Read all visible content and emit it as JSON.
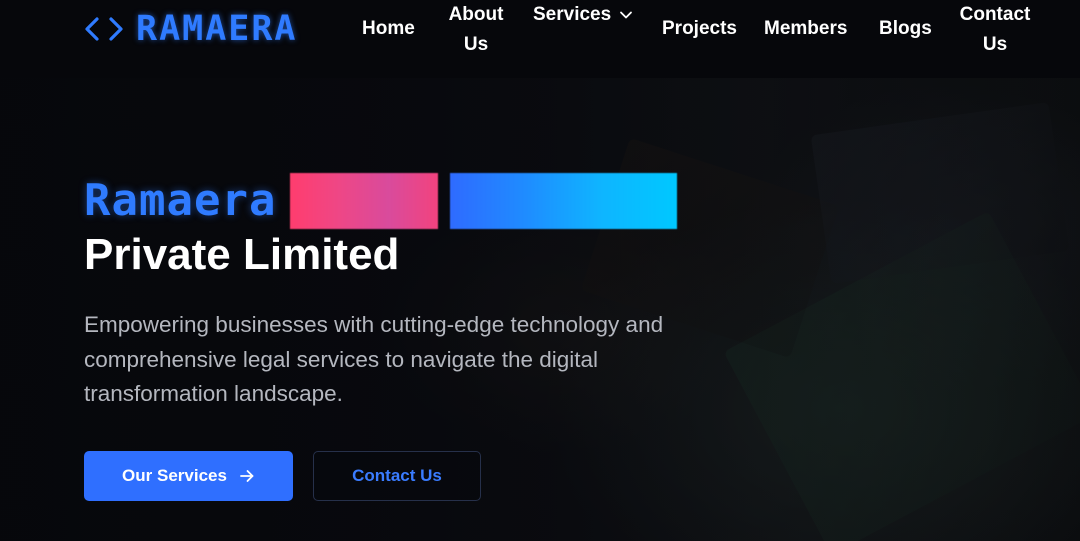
{
  "header": {
    "logo_text": "RAMAERA",
    "nav": {
      "home": "Home",
      "about_line1": "About",
      "about_line2": "Us",
      "services": "Services",
      "projects": "Projects",
      "members": "Members",
      "blogs": "Blogs",
      "contact_line1": "Contact",
      "contact_line2": "Us"
    }
  },
  "hero": {
    "brand_word": "Ramaera",
    "title_line2": "Private Limited",
    "description": "Empowering businesses with cutting-edge technology and comprehensive legal services to navigate the digital transformation landscape.",
    "primary_button": "Our Services",
    "secondary_button": "Contact Us"
  },
  "colors": {
    "accent": "#2f7bff",
    "primary_button": "#2f6fff",
    "background": "#06070b"
  },
  "icons": {
    "logo": "code-brackets-icon",
    "services_dropdown": "chevron-down-icon",
    "primary_button": "arrow-right-icon"
  }
}
